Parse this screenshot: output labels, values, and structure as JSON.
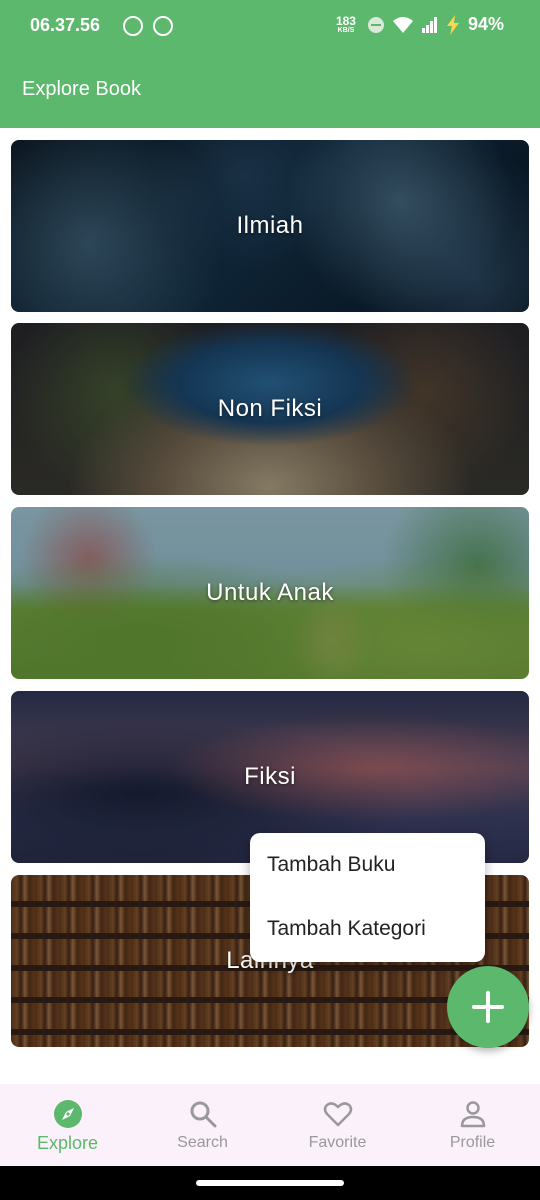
{
  "status_bar": {
    "time": "06.37.56",
    "net_speed": "183",
    "net_unit": "KB/S",
    "battery": "94%"
  },
  "app_bar": {
    "title": "Explore Book"
  },
  "categories": [
    {
      "label": "Ilmiah"
    },
    {
      "label": "Non Fiksi"
    },
    {
      "label": "Untuk Anak"
    },
    {
      "label": "Fiksi"
    },
    {
      "label": "Lainnya"
    }
  ],
  "popup_menu": {
    "items": [
      {
        "label": "Tambah Buku"
      },
      {
        "label": "Tambah Kategori"
      }
    ]
  },
  "bottom_nav": {
    "items": [
      {
        "label": "Explore",
        "icon": "compass-icon",
        "active": true
      },
      {
        "label": "Search",
        "icon": "search-icon",
        "active": false
      },
      {
        "label": "Favorite",
        "icon": "heart-icon",
        "active": false
      },
      {
        "label": "Profile",
        "icon": "person-icon",
        "active": false
      }
    ]
  },
  "colors": {
    "primary": "#5cb86c",
    "nav_background": "#fbf1fa",
    "inactive": "#999999"
  }
}
